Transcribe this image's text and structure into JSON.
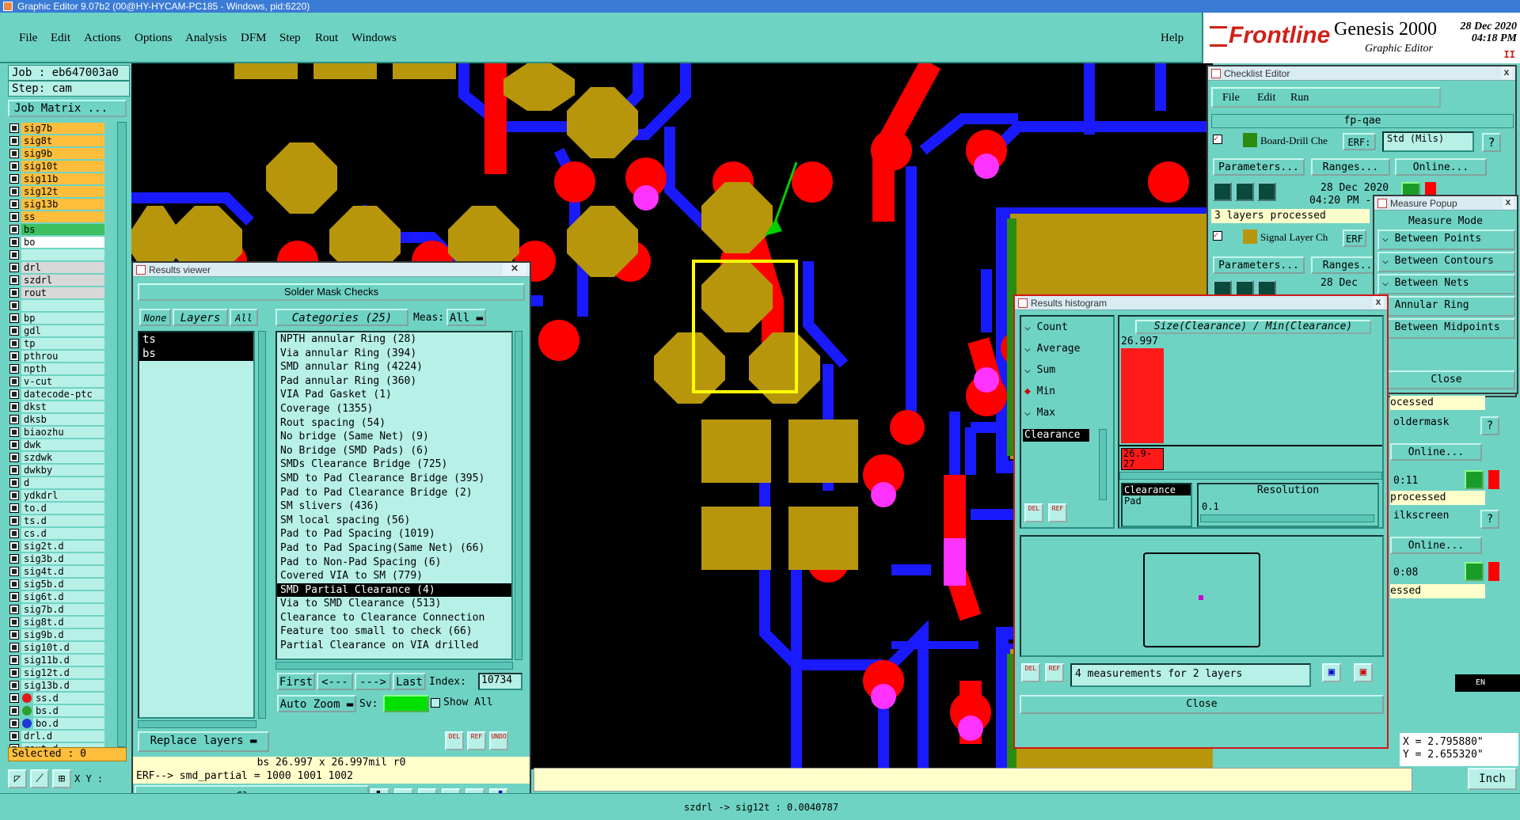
{
  "window": {
    "title": "Graphic Editor 9.07b2 (00@HY-HYCAM-PC185 - Windows, pid:6220)"
  },
  "menu": [
    "File",
    "Edit",
    "Actions",
    "Options",
    "Analysis",
    "DFM",
    "Step",
    "Rout",
    "Windows"
  ],
  "menu_help": "Help",
  "brand": {
    "logo": "Frontline",
    "product": "Genesis 2000",
    "subtitle": "Graphic Editor",
    "date": "28 Dec 2020",
    "time": "04:18 PM",
    "pause": "II"
  },
  "left": {
    "job": "Job : eb647003a0",
    "step": "Step: cam",
    "matrix_button": "Job Matrix ...",
    "layers": [
      {
        "name": "sig7b",
        "color": "orange"
      },
      {
        "name": "sig8t",
        "color": "orange"
      },
      {
        "name": "sig9b",
        "color": "orange"
      },
      {
        "name": "sig10t",
        "color": "orange"
      },
      {
        "name": "sig11b",
        "color": "orange"
      },
      {
        "name": "sig12t",
        "color": "orange"
      },
      {
        "name": "sig13b",
        "color": "orange"
      },
      {
        "name": "ss",
        "color": "orange"
      },
      {
        "name": "bs",
        "color": "green"
      },
      {
        "name": "bo",
        "color": "white"
      },
      {
        "name": "",
        "color": "sep"
      },
      {
        "name": "drl",
        "color": "grey"
      },
      {
        "name": "szdrl",
        "color": "grey"
      },
      {
        "name": "rout",
        "color": "grey"
      },
      {
        "name": "",
        "color": "sep"
      },
      {
        "name": "bp",
        "color": ""
      },
      {
        "name": "gdl",
        "color": ""
      },
      {
        "name": "tp",
        "color": ""
      },
      {
        "name": "pthrou",
        "color": ""
      },
      {
        "name": "npth",
        "color": ""
      },
      {
        "name": "v-cut",
        "color": ""
      },
      {
        "name": "datecode-ptc",
        "color": ""
      },
      {
        "name": "dkst",
        "color": ""
      },
      {
        "name": "dksb",
        "color": ""
      },
      {
        "name": "biaozhu",
        "color": ""
      },
      {
        "name": "dwk",
        "color": ""
      },
      {
        "name": "szdwk",
        "color": ""
      },
      {
        "name": "dwkby",
        "color": ""
      },
      {
        "name": "d",
        "color": ""
      },
      {
        "name": "ydkdrl",
        "color": ""
      },
      {
        "name": "to.d",
        "color": ""
      },
      {
        "name": "ts.d",
        "color": ""
      },
      {
        "name": "cs.d",
        "color": ""
      },
      {
        "name": "sig2t.d",
        "color": ""
      },
      {
        "name": "sig3b.d",
        "color": ""
      },
      {
        "name": "sig4t.d",
        "color": ""
      },
      {
        "name": "sig5b.d",
        "color": ""
      },
      {
        "name": "sig6t.d",
        "color": ""
      },
      {
        "name": "sig7b.d",
        "color": ""
      },
      {
        "name": "sig8t.d",
        "color": ""
      },
      {
        "name": "sig9b.d",
        "color": ""
      },
      {
        "name": "sig10t.d",
        "color": ""
      },
      {
        "name": "sig11b.d",
        "color": ""
      },
      {
        "name": "sig12t.d",
        "color": ""
      },
      {
        "name": "sig13b.d",
        "color": ""
      },
      {
        "name": "ss.d",
        "color": "",
        "dot": "#e81818"
      },
      {
        "name": "bs.d",
        "color": "",
        "dot": "#2ca02c"
      },
      {
        "name": "bo.d",
        "color": "",
        "dot": "#1f3bd6"
      },
      {
        "name": "drl.d",
        "color": ""
      },
      {
        "name": "rout.d",
        "color": ""
      }
    ],
    "selected": "Selected : 0",
    "xy_label": "X Y :"
  },
  "results_viewer": {
    "title": "Results viewer",
    "header": "Solder Mask Checks",
    "none": "None",
    "layers_label": "Layers",
    "all": "All",
    "layers": [
      "ts",
      "bs"
    ],
    "categories_label": "Categories (25)",
    "meas_label": "Meas:",
    "meas_value": "All",
    "categories": [
      "NPTH annular Ring (28)",
      "Via annular Ring (394)",
      "SMD annular Ring (4224)",
      "Pad annular Ring (360)",
      "VIA Pad Gasket (1)",
      "Coverage (1355)",
      "Rout spacing (54)",
      "No bridge (Same Net) (9)",
      "No Bridge (SMD Pads) (6)",
      "SMDs Clearance Bridge (725)",
      "SMD to Pad Clearance Bridge (395)",
      "Pad to Pad Clearance Bridge (2)",
      "SM slivers (436)",
      "SM local spacing (56)",
      "Pad to Pad Spacing (1019)",
      "Pad to Pad Spacing(Same Net) (66)",
      "Pad to Non-Pad Spacing (6)",
      "Covered VIA to SM (779)",
      "SMD Partial Clearance (4)",
      "Via to SMD Clearance (513)",
      "Clearance to Clearance Connection",
      "Feature too small to check (66)",
      "Partial Clearance on VIA drilled"
    ],
    "selected_category_index": 18,
    "nav": [
      "First",
      "<---",
      "--->",
      "Last"
    ],
    "index_label": "Index:",
    "index_value": "10734",
    "auto_zoom": "Auto Zoom",
    "sv_label": "Sv:",
    "show_all": "Show All",
    "replace_layers": "Replace layers",
    "del": "DEL",
    "ref": "REF",
    "undo": "UNDO",
    "size_info": "bs 26.997 x 26.997mil  r0",
    "erf_line": "ERF--> smd_partial = 1000 1001 1002",
    "close": "Close"
  },
  "checklist": {
    "title": "Checklist Editor",
    "menu": [
      "File",
      "Edit",
      "Run"
    ],
    "name": "fp-qae",
    "item1_name": "Board-Drill Che",
    "erf_label": "ERF:",
    "erf_value": "Std (Mils)",
    "help": "?",
    "parameters": "Parameters...",
    "ranges": "Ranges...",
    "online": "Online...",
    "item1_date": "28 Dec 2020",
    "item1_time": "04:20 PM -",
    "item1_status": "3 layers processed",
    "item2_name": "Signal Layer Ch",
    "item2_erf": "ERF",
    "item2_date": "28 Dec",
    "right_frag": [
      "ocessed",
      "oldermask",
      "Online...",
      "0:11",
      "processed",
      "ilkscreen",
      "Online...",
      "0:08",
      "essed"
    ]
  },
  "measure_popup": {
    "title": "Measure Popup",
    "mode": "Measure Mode",
    "options": [
      "Between Points",
      "Between Contours",
      "Between Nets",
      "Annular Ring",
      "Between Midpoints"
    ],
    "close": "Close"
  },
  "histogram": {
    "title": "Results histogram",
    "stats": [
      "Count",
      "Average",
      "Sum",
      "Min",
      "Max"
    ],
    "selected_stat": "Min",
    "attr": "Clearance",
    "chart_title": "Size(Clearance) / Min(Clearance)",
    "bar_value": "26.997",
    "bar_label": "26.9-27",
    "attr2": "Clearance",
    "attr3": "Pad",
    "resolution_label": "Resolution",
    "resolution_value": "0.1",
    "summary": "4 measurements for 2 layers",
    "close": "Close"
  },
  "status": {
    "distance": "szdrl -> sig12t : 0.0040787",
    "x": "X = 2.795880\"",
    "y": "Y = 2.655320\"",
    "units": "Inch",
    "lang": "EN"
  },
  "colors": {
    "panel": "#6fd3c4",
    "pad": "#b8960b",
    "copper_red": "#ff0000",
    "trace_blue": "#1a1aff",
    "overlap": "#ff33ff",
    "highlight": "#ffff00",
    "arrow": "#00d000"
  }
}
